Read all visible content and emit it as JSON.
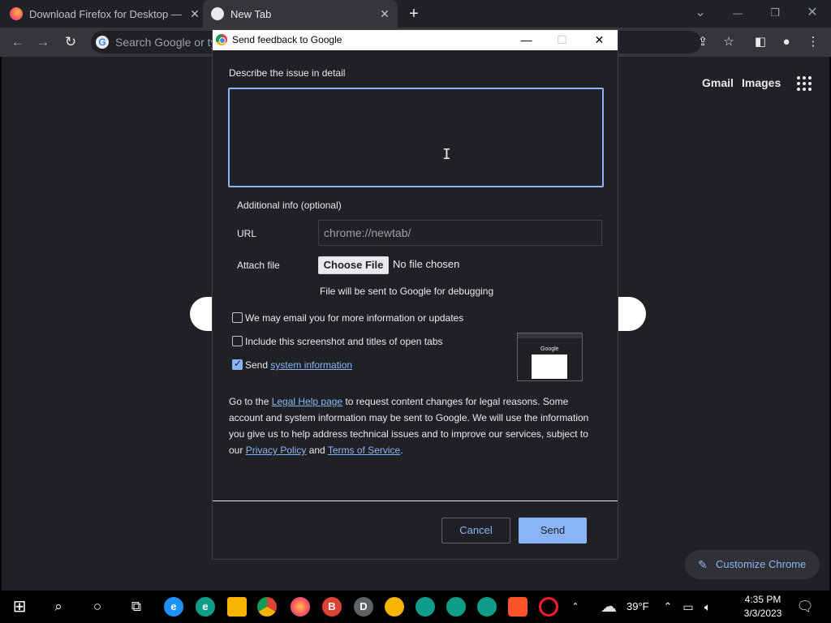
{
  "browser": {
    "tabs": [
      {
        "title": "Download Firefox for Desktop —",
        "favicon": "firefox-icon"
      },
      {
        "title": "New Tab",
        "favicon": "chrome-icon"
      }
    ],
    "new_tab_glyph": "+",
    "omnibox_placeholder": "Search Google or ty",
    "window_controls": {
      "tab_search": "⌄",
      "minimize": "—",
      "restore": "❐",
      "close": "✕"
    }
  },
  "ntp": {
    "links": {
      "gmail": "Gmail",
      "images": "Images"
    },
    "customize_label": "Customize Chrome"
  },
  "dialog": {
    "title": "Send feedback to Google",
    "describe_label": "Describe the issue in detail",
    "describe_value": "",
    "additional_info_label": "Additional info (optional)",
    "url_label": "URL",
    "url_value": "chrome://newtab/",
    "attach_label": "Attach file",
    "choose_file_label": "Choose File",
    "no_file_label": "No file chosen",
    "debug_note": "File will be sent to Google for debugging",
    "checkboxes": {
      "email": {
        "label": "We may email you for more information or updates",
        "checked": false
      },
      "screenshot": {
        "label": "Include this screenshot and titles of open tabs",
        "checked": false
      },
      "sysinfo": {
        "label_prefix": "Send",
        "link": "system information",
        "checked": true
      }
    },
    "thumbnail_text": "Google",
    "legal": {
      "part1": "Go to the ",
      "legal_link": "Legal Help page",
      "part2": " to request content changes for legal reasons. Some account and system information may be sent to Google. We will use the information you give us to help address technical issues and to improve our services, subject to our ",
      "privacy_link": "Privacy Policy",
      "part3": " and ",
      "tos_link": "Terms of Service",
      "part4": "."
    },
    "cancel_label": "Cancel",
    "send_label": "Send"
  },
  "taskbar": {
    "weather": "39°F",
    "time": "4:35 PM",
    "date": "3/3/2023",
    "badges": {
      "beta": "B",
      "dev": "D"
    }
  },
  "colors": {
    "accent": "#8ab4f8",
    "background": "#202124",
    "toolbar": "#35363a"
  }
}
